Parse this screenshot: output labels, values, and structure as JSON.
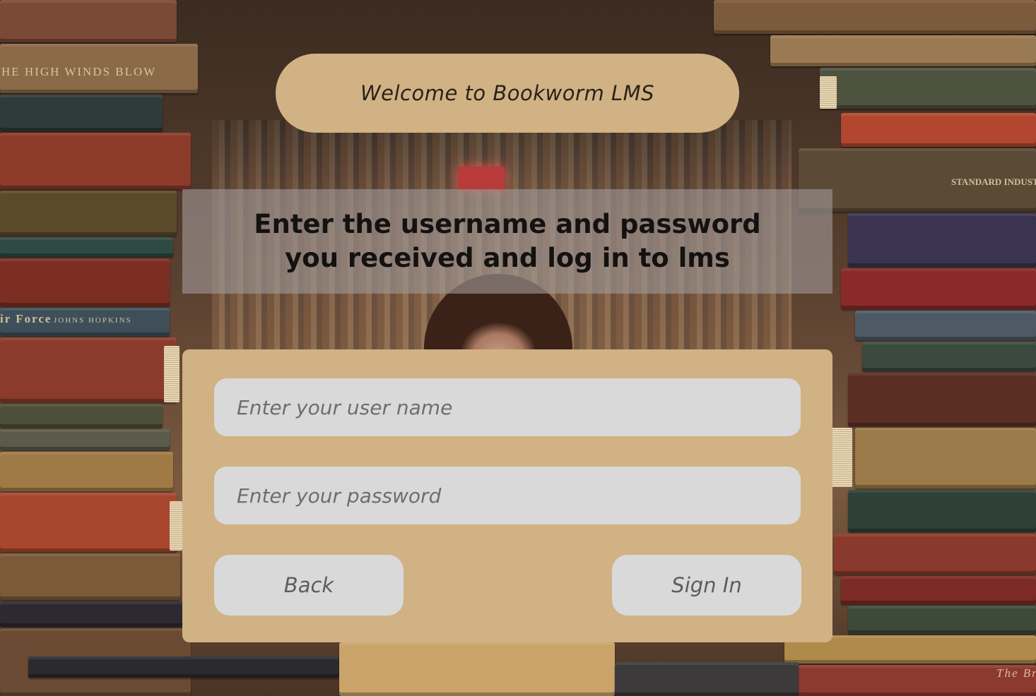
{
  "header": {
    "title": "Welcome to Bookworm LMS"
  },
  "instructions": {
    "text": "Enter the username and password you received and log in to lms"
  },
  "login_form": {
    "username_placeholder": "Enter your user name",
    "username_value": "",
    "password_placeholder": "Enter your password",
    "password_value": "",
    "back_label": "Back",
    "signin_label": "Sign In"
  },
  "background": {
    "spine_texts": [
      "HE HIGH WINDS BLOW",
      "ir Force",
      "JOHNS HOPKINS",
      "STANDARD INDUSTRI",
      "The Br"
    ]
  },
  "colors": {
    "panel_tan": "#d1b284",
    "field_gray": "#d9d9d9",
    "overlay_gray": "rgba(160,152,150,0.62)",
    "title_text": "#141210"
  }
}
